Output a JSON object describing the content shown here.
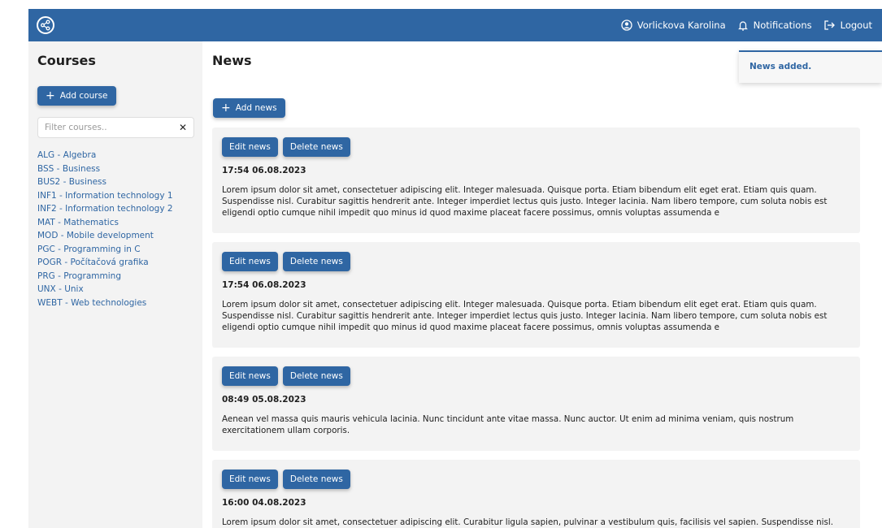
{
  "navbar": {
    "logo_icon": "share-icon",
    "user_name": "Vorlickova Karolina",
    "notifications_label": "Notifications",
    "logout_label": "Logout",
    "accent_color": "#2f66a3"
  },
  "sidebar": {
    "title": "Courses",
    "add_course_label": "Add course",
    "filter_placeholder": "Filter courses..",
    "filter_value": "",
    "courses": [
      "ALG - Algebra",
      "BSS - Business",
      "BUS2 - Business",
      "INF1 - Information technology 1",
      "INF2 - Information technology 2",
      "MAT - Mathematics",
      "MOD - Mobile development",
      "PGC - Programming in C",
      "POGR - Počítačová grafika",
      "PRG - Programming",
      "UNX - Unix",
      "WEBT - Web technologies"
    ]
  },
  "main": {
    "title": "News",
    "add_news_label": "Add news",
    "toast_message": "News added.",
    "edit_label": "Edit news",
    "delete_label": "Delete news",
    "news": [
      {
        "date": "17:54 06.08.2023",
        "text": "Lorem ipsum dolor sit amet, consectetuer adipiscing elit. Integer malesuada. Quisque porta. Etiam bibendum elit eget erat. Etiam quis quam. Suspendisse nisl. Curabitur sagittis hendrerit ante. Integer imperdiet lectus quis justo. Integer lacinia. Nam libero tempore, cum soluta nobis est eligendi optio cumque nihil impedit quo minus id quod maxime placeat facere possimus, omnis voluptas assumenda e"
      },
      {
        "date": "17:54 06.08.2023",
        "text": "Lorem ipsum dolor sit amet, consectetuer adipiscing elit. Integer malesuada. Quisque porta. Etiam bibendum elit eget erat. Etiam quis quam. Suspendisse nisl. Curabitur sagittis hendrerit ante. Integer imperdiet lectus quis justo. Integer lacinia. Nam libero tempore, cum soluta nobis est eligendi optio cumque nihil impedit quo minus id quod maxime placeat facere possimus, omnis voluptas assumenda e"
      },
      {
        "date": "08:49 05.08.2023",
        "text": "Aenean vel massa quis mauris vehicula lacinia. Nunc tincidunt ante vitae massa. Nunc auctor. Ut enim ad minima veniam, quis nostrum exercitationem ullam corporis."
      },
      {
        "date": "16:00 04.08.2023",
        "text": "Lorem ipsum dolor sit amet, consectetuer adipiscing elit. Curabitur ligula sapien, pulvinar a vestibulum quis, facilisis vel sapien. Suspendisse nisl. Suspendisse"
      }
    ]
  }
}
